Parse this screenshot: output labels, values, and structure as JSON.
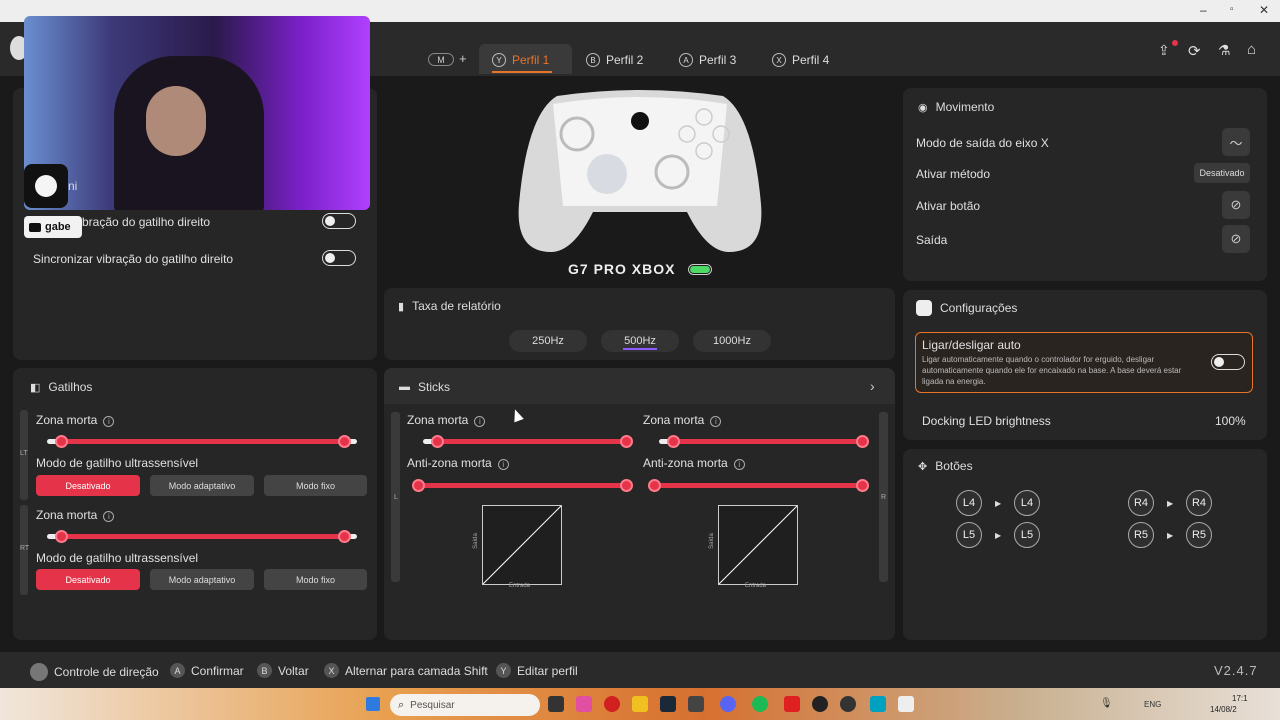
{
  "tabs": {
    "m_label": "M",
    "plus": "+",
    "items": [
      {
        "badge": "Y",
        "label": "Perfil 1"
      },
      {
        "badge": "B",
        "label": "Perfil 2"
      },
      {
        "badge": "A",
        "label": "Perfil 3"
      },
      {
        "badge": "X",
        "label": "Perfil 4"
      }
    ]
  },
  "webcam": {
    "name_tag": "gabe",
    "partial_text": "ni"
  },
  "vibration": {
    "row1": "bração do gatilho direito",
    "row2": "Sincronizar vibração do gatilho direito"
  },
  "controller": {
    "name": "G7 PRO XBOX"
  },
  "report_rate": {
    "title": "Taxa de relatório",
    "options": [
      "250Hz",
      "500Hz",
      "1000Hz"
    ],
    "selected": "500Hz"
  },
  "triggers": {
    "title": "Gatilhos",
    "lt_tag": "LT",
    "rt_tag": "RT",
    "deadzone_label": "Zona morta",
    "mode_label": "Modo de gatilho ultrassensível",
    "modes": [
      "Desativado",
      "Modo adaptativo",
      "Modo fixo"
    ]
  },
  "sticks": {
    "title": "Sticks",
    "deadzone_label": "Zona morta",
    "anti_deadzone_label": "Anti-zona morta",
    "input_label": "Entrada",
    "output_label": "Saída",
    "l_tag": "L",
    "r_tag": "R"
  },
  "movement": {
    "title": "Movimento",
    "rows": {
      "x_axis": "Modo de saída do eixo X",
      "activate_method": "Ativar método",
      "activate_button": "Ativar botão",
      "output": "Saída"
    },
    "method_value": "Desativado"
  },
  "settings": {
    "title": "Configurações",
    "auto_title": "Ligar/desligar auto",
    "auto_desc": "Ligar automaticamente quando o controlador for erguido, desligar automaticamente quando ele for encaixado na base. A base deverá estar ligada na energia.",
    "led_label": "Docking LED brightness",
    "led_value": "100%"
  },
  "buttons": {
    "title": "Botões",
    "mappings": [
      [
        "L4",
        "L4"
      ],
      [
        "L5",
        "L5"
      ],
      [
        "R4",
        "R4"
      ],
      [
        "R5",
        "R5"
      ]
    ]
  },
  "footer": {
    "items": [
      {
        "badge": "",
        "label": "Controle de direção"
      },
      {
        "badge": "A",
        "label": "Confirmar"
      },
      {
        "badge": "B",
        "label": "Voltar"
      },
      {
        "badge": "X",
        "label": "Alternar para camada Shift"
      },
      {
        "badge": "Y",
        "label": "Editar perfil"
      }
    ],
    "version": "V2.4.7"
  },
  "taskbar": {
    "search_placeholder": "Pesquisar",
    "lang": "ENG",
    "time": "17:1",
    "date": "14/08/2"
  },
  "colors": {
    "accent": "#e5344a",
    "orange_border": "#e8732a",
    "battery": "#4cd964"
  }
}
